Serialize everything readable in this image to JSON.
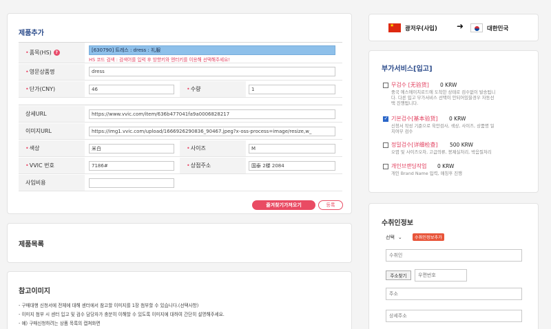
{
  "product_add": {
    "title": "제품추가",
    "fields": {
      "hs": {
        "label": "품목(HS)",
        "value": "[630790] 트레스 : dress : 礼服",
        "hint": "HS 코드 검색 : 검색어를 입력 후 방향키와 엔터키를 이용해 선택해주세요!"
      },
      "english_name": {
        "label": "영문상품명",
        "value": "dress"
      },
      "unit_price": {
        "label": "단가(CNY)",
        "value": "46"
      },
      "quantity": {
        "label": "수량",
        "value": "1"
      },
      "detail_url": {
        "label": "상세URL",
        "value": "https://www.vvic.com/item/636b477041fa9a0006828217"
      },
      "image_url": {
        "label": "이미지URL",
        "value": "https://img1.vvic.com/upload/1666926290836_90467.jpeg?x-oss-process=image/resize,w_"
      },
      "color": {
        "label": "색상",
        "value": "米白"
      },
      "size": {
        "label": "사이즈",
        "value": "M"
      },
      "vvic_no": {
        "label": "VVIC 번호",
        "value": "7186#"
      },
      "store_address": {
        "label": "상점주소",
        "value": "国泰 2楼 2084"
      },
      "business_cost": {
        "label": "사입비용",
        "value": ""
      }
    },
    "btn_favorite": "즐겨찾기가져오기",
    "btn_register": "등록"
  },
  "product_list": {
    "title": "제품목록"
  },
  "reference_image": {
    "title": "참고이미지",
    "notes": [
      "- 구매대행 신청서에 전체에 대해 센터에서 참고할 이미지를 1장 첨부할 수 있습니다.(선택사항)",
      "- 이미지 첨부 시 센터 입고 및 검수 담당자가 충분히 이해할 수 있도록 이미지에 대하여 간단히 설명해주세요.",
      "- 예) 구매신청하려는 상품 목록의 캡쳐화면"
    ]
  },
  "route": {
    "from": "광저우(사입)",
    "to": "대한민국"
  },
  "extra_services": {
    "title": "부가서비스[입고]",
    "items": [
      {
        "name": "무검수 [无验货]",
        "price": "0 KRW",
        "desc": [
          "중국 에스에이치로드에 도착한 상태로 검수없이 발송됩니",
          "다. 다른 입고 부가서비스 선택이 안되어있을경우 자동선",
          "택 진행됩니다."
        ],
        "checked": false
      },
      {
        "name": "기본검수[基本验货]",
        "price": "0 KRW",
        "desc": [
          "신청서 작성 기준으로 육안검사, 색상, 사이즈, 상품명 일",
          "치여부 검수"
        ],
        "checked": true
      },
      {
        "name": "정밀검수[详细检查]",
        "price": "500 KRW",
        "desc": [
          "오염 및 사이즈오차, 고급의류, 봉제실처리, 박음질처리"
        ],
        "checked": false
      },
      {
        "name": "개인브랜딩작업",
        "price": "0 KRW",
        "desc": [
          "개인 Brand Name 입력, 매칭후 진행"
        ],
        "checked": false
      }
    ]
  },
  "recipient": {
    "title": "수취인정보",
    "select_value": "선택",
    "add_tag": "수취인정보추가",
    "name_placeholder": "수취인",
    "zip_button": "주소찾기",
    "zip_placeholder": "우편번호",
    "address_placeholder": "주소",
    "detail_address_placeholder": "상세주소"
  }
}
